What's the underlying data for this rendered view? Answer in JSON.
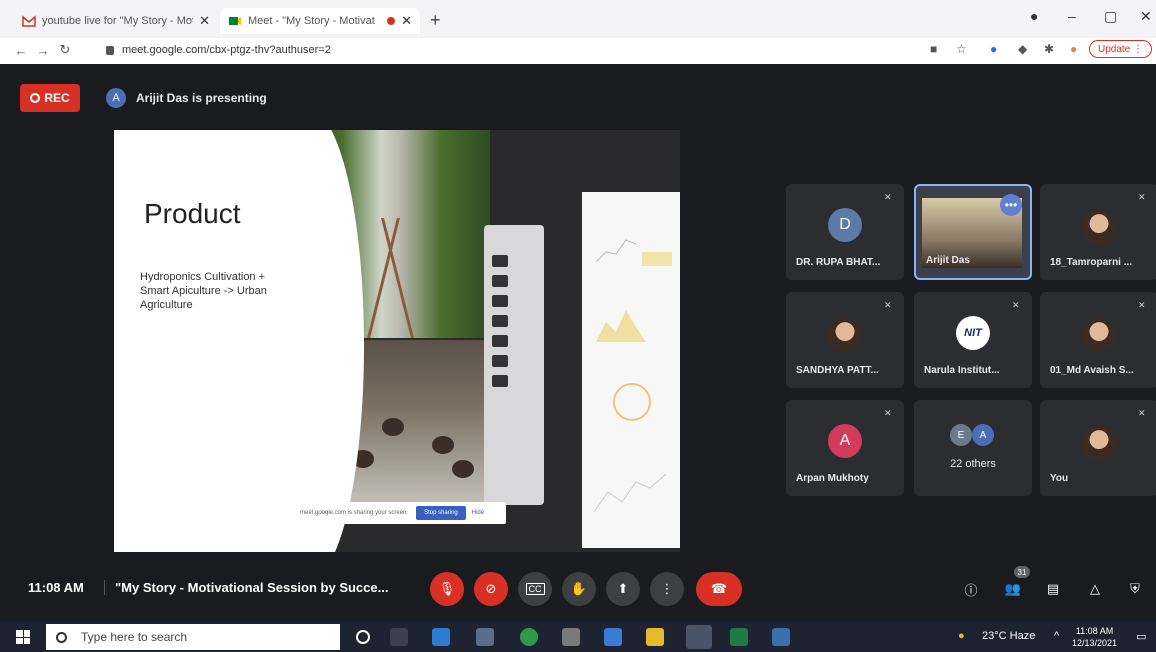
{
  "browser": {
    "tabs": [
      {
        "title": "youtube live for \"My Story - Mot",
        "favicon": "gmail-icon",
        "active": false
      },
      {
        "title": "Meet - \"My Story - Motivat",
        "favicon": "meet-icon",
        "active": true,
        "recording": true
      }
    ],
    "new_tab": "+",
    "url": "meet.google.com/cbx-ptgz-thv?authuser=2",
    "update_label": "Update",
    "window_controls": [
      "–",
      "▢",
      "✕"
    ]
  },
  "meet": {
    "rec_label": "REC",
    "presenter_initial": "A",
    "presenter_text": "Arijit Das is presenting",
    "slide": {
      "title": "Product",
      "body": "Hydroponics Cultivation + Smart Apiculture -> Urban Agriculture"
    },
    "share_bar": {
      "text": "meet.google.com is sharing your screen.",
      "stop_label": "Stop sharing",
      "hide_label": "Hide"
    },
    "participants": [
      {
        "name": "DR. RUPA BHAT...",
        "initial": "D",
        "color": "#5e7aa8",
        "type": "initial"
      },
      {
        "name": "Arijit Das",
        "type": "video",
        "active": true
      },
      {
        "name": "18_Tamroparni ...",
        "type": "photo"
      },
      {
        "name": "SANDHYA PATT...",
        "type": "photo"
      },
      {
        "name": "Narula Institut...",
        "type": "logo",
        "logo_text": "NIT"
      },
      {
        "name": "01_Md Avaish S...",
        "type": "photo"
      },
      {
        "name": "Arpan Mukhoty",
        "initial": "A",
        "color": "#d33b5c",
        "type": "initial"
      },
      {
        "name": "22 others",
        "type": "others",
        "initials": [
          "E",
          "A"
        ]
      },
      {
        "name": "You",
        "type": "photo"
      }
    ],
    "time": "11:08 AM",
    "meeting_title": "\"My Story - Motivational Session by Succe...",
    "people_count": "31"
  },
  "taskbar": {
    "search_placeholder": "Type here to search",
    "weather": "23°C Haze",
    "clock_time": "11:08 AM",
    "clock_date": "12/13/2021"
  }
}
